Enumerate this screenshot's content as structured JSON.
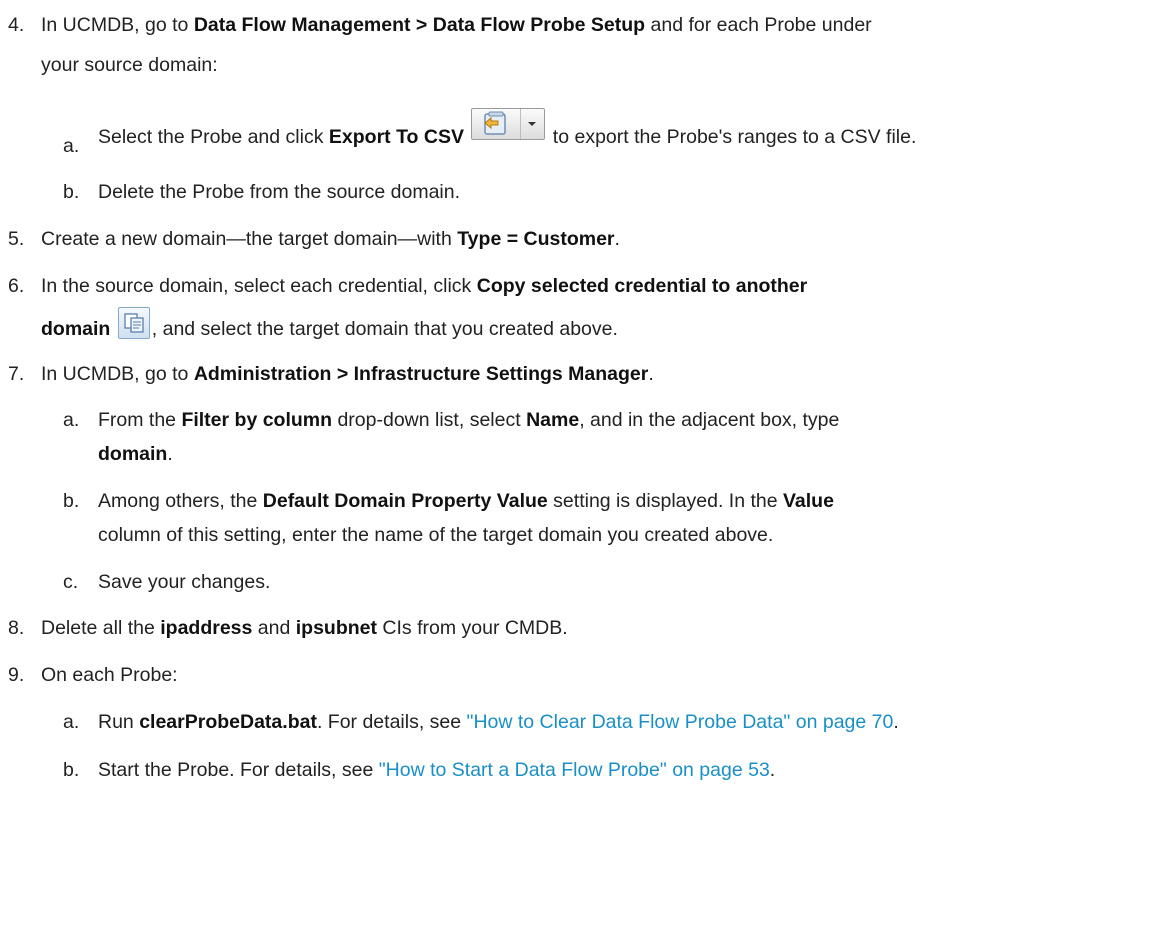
{
  "steps": {
    "s4": {
      "num": "4.",
      "text_a": "In UCMDB, go to ",
      "bold_a": "Data Flow Management > Data Flow Probe Setup",
      "text_b": " and for each Probe under",
      "line2": "your source domain:",
      "sub_a": {
        "letter": "a.",
        "text_a": "Select the Probe and click ",
        "bold_a": "Export To CSV",
        "text_b": " to export the Probe's ranges to a CSV file.",
        "icon": "export-to-csv-icon"
      },
      "sub_b": {
        "letter": "b.",
        "text": "Delete the Probe from the source domain."
      }
    },
    "s5": {
      "num": "5.",
      "text_a": "Create a new domain—the target domain—with ",
      "bold_a": "Type = Customer",
      "text_b": "."
    },
    "s6": {
      "num": "6.",
      "text_a": "In the source domain, select each credential, click ",
      "bold_a": "Copy selected credential to another",
      "bold_b": "domain",
      "text_b": ", and select the target domain that you created above.",
      "icon": "copy-credential-icon"
    },
    "s7": {
      "num": "7.",
      "text_a": "In UCMDB, go to ",
      "bold_a": "Administration > Infrastructure Settings Manager",
      "text_b": ".",
      "sub_a": {
        "letter": "a.",
        "t1": "From the ",
        "b1": "Filter by column",
        "t2": " drop-down list, select ",
        "b2": "Name",
        "t3": ", and in the adjacent box, type",
        "b3": "domain",
        "t4": "."
      },
      "sub_b": {
        "letter": "b.",
        "t1": "Among others, the ",
        "b1": "Default Domain Property Value",
        "t2": " setting is displayed. In the ",
        "b2": "Value",
        "line2": "column of this setting, enter the name of the target domain you created above."
      },
      "sub_c": {
        "letter": "c.",
        "text": "Save your changes."
      }
    },
    "s8": {
      "num": "8.",
      "t1": "Delete all the ",
      "b1": "ipaddress",
      "t2": " and ",
      "b2": "ipsubnet",
      "t3": " CIs from your CMDB."
    },
    "s9": {
      "num": "9.",
      "text": "On each Probe:",
      "sub_a": {
        "letter": "a.",
        "t1": "Run ",
        "b1": "clearProbeData.bat",
        "t2": ". For details, see ",
        "link": "\"How to Clear Data Flow Probe Data\" on page 70",
        "t3": "."
      },
      "sub_b": {
        "letter": "b.",
        "t1": "Start the Probe. For details, see ",
        "link": "\"How to Start a Data Flow Probe\" on page 53",
        "t2": "."
      }
    }
  },
  "colors": {
    "text": "#222222",
    "link": "#1a8fc7"
  }
}
